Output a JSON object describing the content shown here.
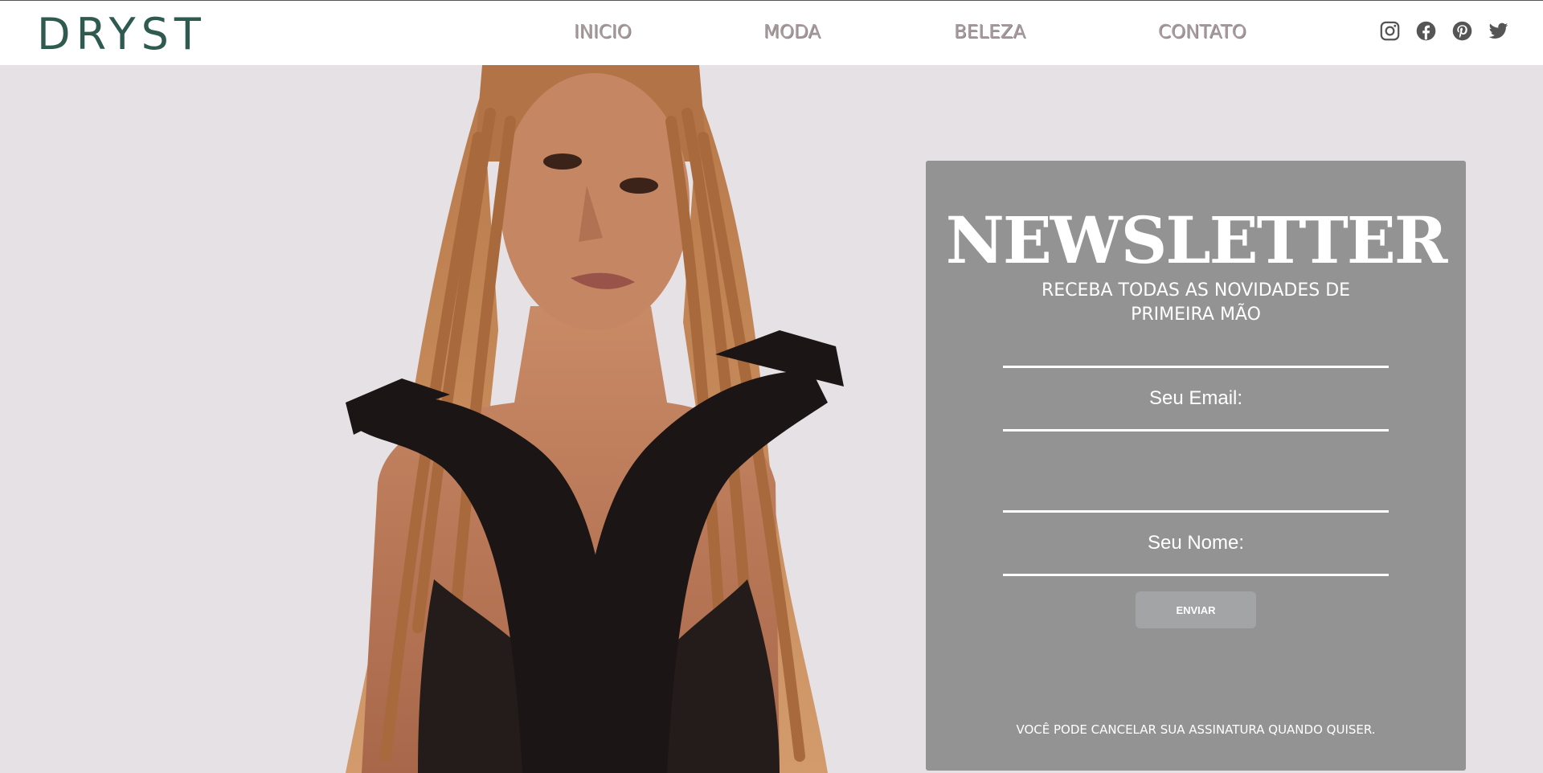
{
  "brand": {
    "logo": "DRYST"
  },
  "nav": {
    "items": [
      {
        "label": "INICIO"
      },
      {
        "label": "MODA"
      },
      {
        "label": "BELEZA"
      },
      {
        "label": "CONTATO"
      }
    ]
  },
  "social": {
    "icons": [
      "instagram-icon",
      "facebook-icon",
      "pinterest-icon",
      "twitter-icon"
    ]
  },
  "newsletter": {
    "title": "NEWSLETTER",
    "subtitle": "RECEBA TODAS AS NOVIDADES DE PRIMEIRA MÃO",
    "email_label": "Seu Email:",
    "name_label": "Seu Nome:",
    "submit_label": "ENVIAR",
    "footnote": "VOCÊ PODE CANCELAR SUA ASSINATURA QUANDO QUISER."
  },
  "colors": {
    "brand": "#2e5a50",
    "nav_text": "#a79b9e",
    "panel_bg": "#939393",
    "page_bg": "#e5e1e4"
  }
}
